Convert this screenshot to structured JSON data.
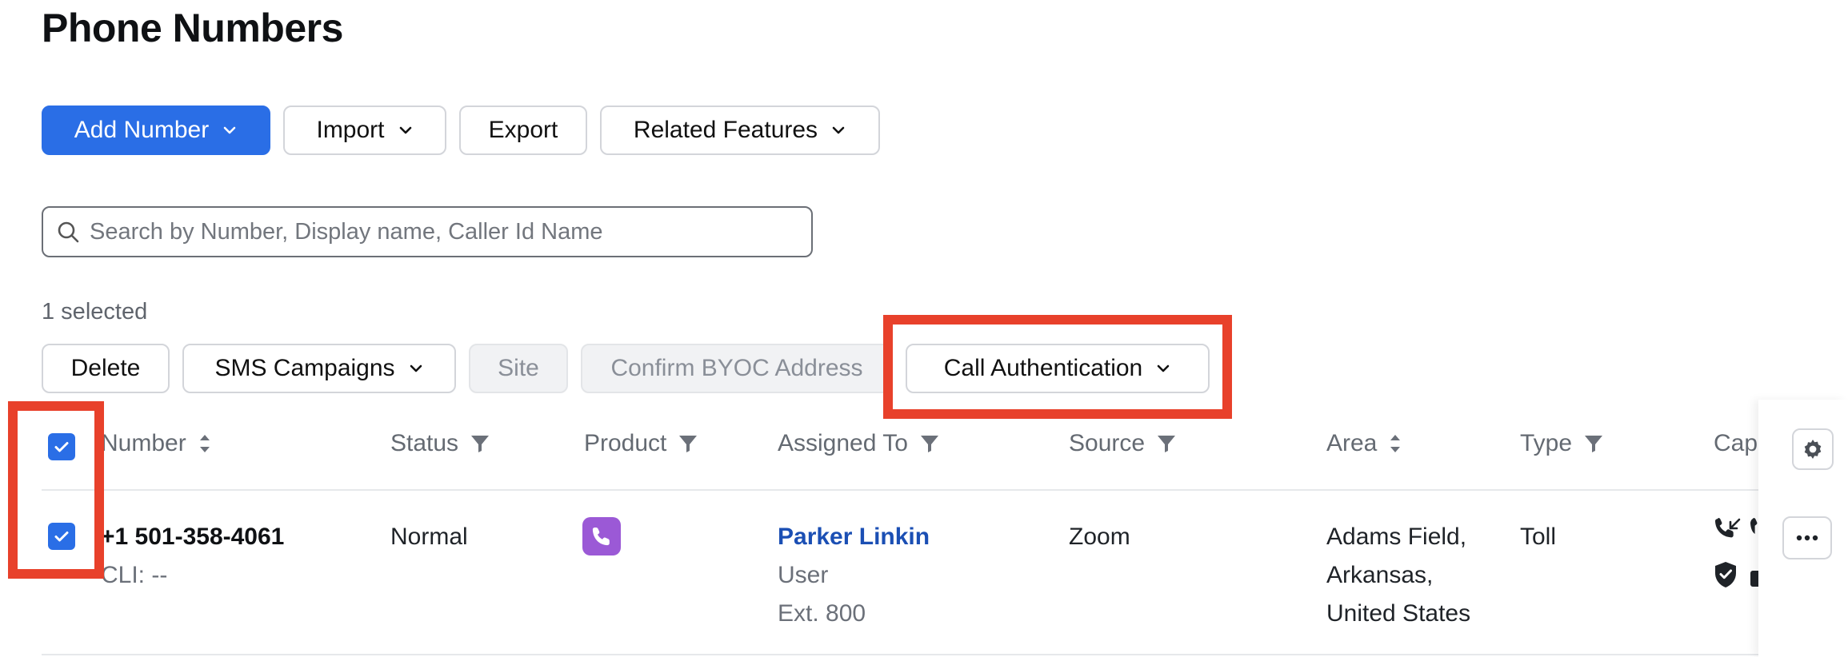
{
  "page": {
    "title": "Phone Numbers"
  },
  "toolbar": {
    "add_number": "Add Number",
    "import": "Import",
    "export": "Export",
    "related_features": "Related Features"
  },
  "search": {
    "placeholder": "Search by Number, Display name, Caller Id Name",
    "value": ""
  },
  "selection": {
    "count_label": "1 selected",
    "delete": "Delete",
    "sms_campaigns": "SMS Campaigns",
    "site": "Site",
    "confirm_byoc": "Confirm BYOC Address",
    "call_authentication": "Call Authentication"
  },
  "table": {
    "columns": {
      "number": "Number",
      "status": "Status",
      "product": "Product",
      "assigned_to": "Assigned To",
      "source": "Source",
      "area": "Area",
      "type": "Type",
      "capabilities": "Capa"
    },
    "rows": [
      {
        "selected": true,
        "number": "+1 501-358-4061",
        "cli": "CLI: --",
        "status": "Normal",
        "product_icon": "phone-icon",
        "assignee_name": "Parker Linkin",
        "assignee_role": "User",
        "assignee_ext": "Ext. 800",
        "source": "Zoom",
        "area_line1": "Adams Field,",
        "area_line2": "Arkansas,",
        "area_line3": "United States",
        "type": "Toll"
      }
    ]
  },
  "colors": {
    "primary": "#2a6ee6",
    "highlight": "#e8412b",
    "link": "#1b4fb4",
    "product": "#9b59d6"
  }
}
